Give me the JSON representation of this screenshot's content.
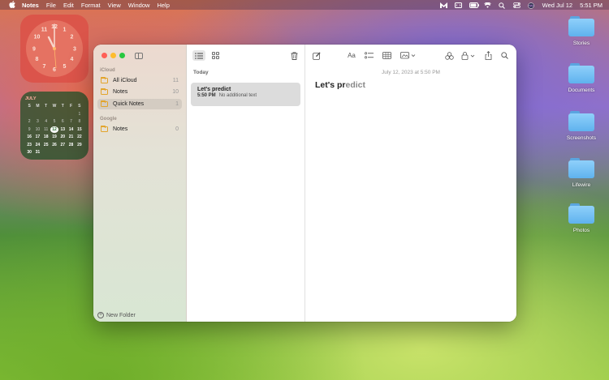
{
  "menubar": {
    "app_name": "Notes",
    "menus": [
      "File",
      "Edit",
      "Format",
      "View",
      "Window",
      "Help"
    ],
    "datetime_day": "Wed Jul 12",
    "datetime_time": "5:51 PM"
  },
  "calendar_widget": {
    "month": "JULY",
    "weekdays": [
      "S",
      "M",
      "T",
      "W",
      "T",
      "F",
      "S"
    ],
    "today": "12",
    "weeks": [
      [
        "",
        "",
        "",
        "",
        "",
        "",
        "1"
      ],
      [
        "2",
        "3",
        "4",
        "5",
        "6",
        "7",
        "8"
      ],
      [
        "9",
        "10",
        "11",
        "12",
        "13",
        "14",
        "15"
      ],
      [
        "16",
        "17",
        "18",
        "19",
        "20",
        "21",
        "22"
      ],
      [
        "23",
        "24",
        "25",
        "26",
        "27",
        "28",
        "29"
      ],
      [
        "30",
        "31",
        "",
        "",
        "",
        "",
        ""
      ]
    ]
  },
  "desktop_folders": [
    {
      "label": "Stories"
    },
    {
      "label": "Documents"
    },
    {
      "label": "Screenshots"
    },
    {
      "label": "Lifewire"
    },
    {
      "label": "Photos"
    }
  ],
  "sidebar": {
    "sections": [
      {
        "label": "iCloud",
        "items": [
          {
            "name": "All iCloud",
            "count": "11",
            "selected": false
          },
          {
            "name": "Notes",
            "count": "10",
            "selected": false
          },
          {
            "name": "Quick Notes",
            "count": "1",
            "selected": true
          }
        ]
      },
      {
        "label": "Google",
        "items": [
          {
            "name": "Notes",
            "count": "0",
            "selected": false
          }
        ]
      }
    ],
    "new_folder_label": "New Folder"
  },
  "list": {
    "group_label": "Today",
    "notes": [
      {
        "title": "Let's predict",
        "time": "5:50 PM",
        "preview": "No additional text"
      }
    ]
  },
  "editor": {
    "date": "July 12, 2023 at 5:50 PM",
    "title_main": "Let's pr",
    "title_faint": "edict",
    "format_label": "Aa"
  }
}
